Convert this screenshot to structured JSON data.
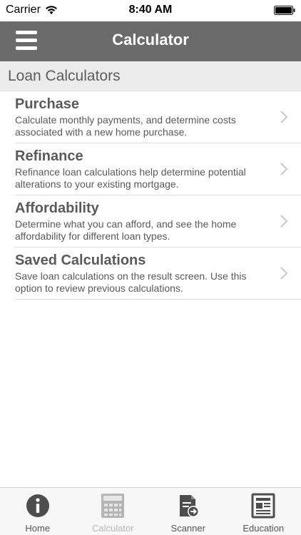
{
  "status_bar": {
    "carrier": "Carrier",
    "time": "8:40 AM"
  },
  "nav": {
    "title": "Calculator"
  },
  "section": {
    "title": "Loan Calculators"
  },
  "items": [
    {
      "title": "Purchase",
      "description": "Calculate monthly payments, and determine costs associated with a new home purchase."
    },
    {
      "title": "Refinance",
      "description": "Refinance loan calculations help determine potential alterations to your existing mortgage."
    },
    {
      "title": "Affordability",
      "description": "Determine what you can afford, and see the home affordability for different loan types."
    },
    {
      "title": "Saved Calculations",
      "description": "Save loan calculations on the result screen. Use this option to review previous calculations."
    }
  ],
  "tabs": [
    {
      "label": "Home",
      "icon": "info-icon",
      "active": false
    },
    {
      "label": "Calculator",
      "icon": "calculator-icon",
      "active": true
    },
    {
      "label": "Scanner",
      "icon": "scanner-icon",
      "active": false
    },
    {
      "label": "Education",
      "icon": "newspaper-icon",
      "active": false
    }
  ],
  "colors": {
    "nav_bg": "#6b6b6b",
    "section_bg": "#ececec",
    "text": "#5a5a5a",
    "tab_inactive_label": "#555555",
    "tab_active_label": "#b8b8b8"
  }
}
